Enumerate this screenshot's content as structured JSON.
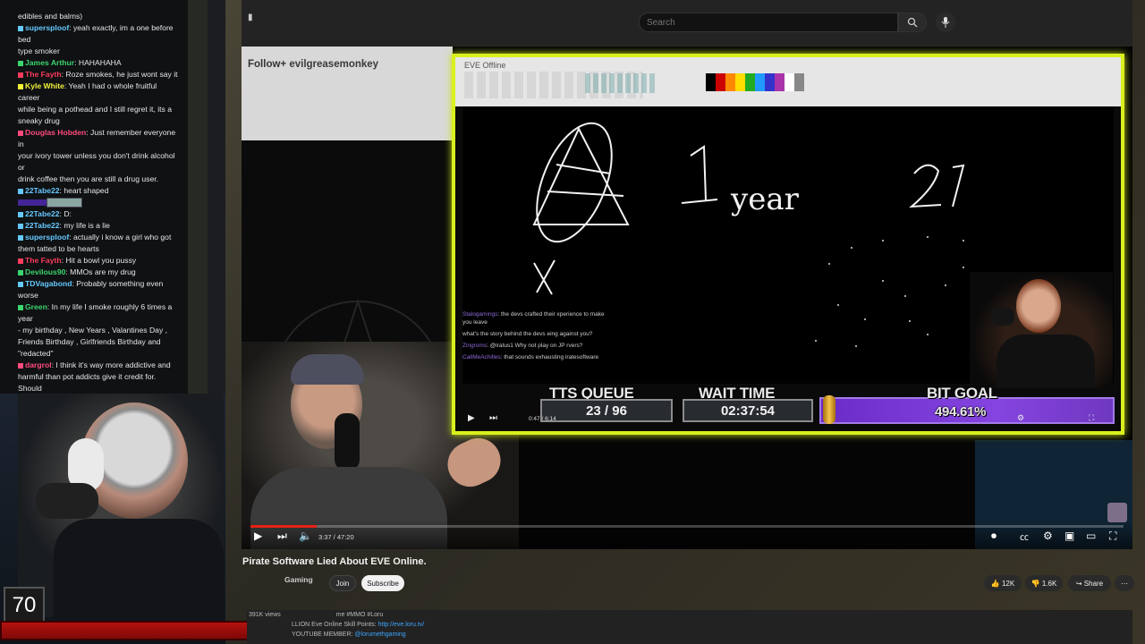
{
  "chat": {
    "messages": [
      {
        "user": "",
        "user_color": "#ffffff",
        "text": "edibles and balms)"
      },
      {
        "user": "supersploof",
        "user_color": "#66c8ff",
        "text": ": yeah exactly, im a one before bed"
      },
      {
        "user": "",
        "user_color": "#ffffff",
        "text": "type smoker"
      },
      {
        "user": "James Arthur",
        "user_color": "#3bd66e",
        "text": ": HAHAHAHA"
      },
      {
        "user": "The Fayth",
        "user_color": "#ff3b5c",
        "text": ": Roze smokes, he just wont say it"
      },
      {
        "user": "Kyle White",
        "user_color": "#f2f23a",
        "text": ": Yeah I had o whole fruitful career"
      },
      {
        "user": "",
        "user_color": "#ffffff",
        "text": "while being a pothead and I still regret it, its a"
      },
      {
        "user": "",
        "user_color": "#ffffff",
        "text": "sneaky drug"
      },
      {
        "user": "Douglas Hobden",
        "user_color": "#ff4a7d",
        "text": ": Just remember everyone in"
      },
      {
        "user": "",
        "user_color": "#ffffff",
        "text": "your ivory tower unless you don't drink alcohol or"
      },
      {
        "user": "",
        "user_color": "#ffffff",
        "text": "drink coffee then you are still a drug user."
      },
      {
        "user": "22Tabe22",
        "user_color": "#66c8ff",
        "text": ": heart shaped"
      },
      {
        "user": "",
        "user_color": "#ffffff",
        "text": ""
      },
      {
        "user": "22Tabe22",
        "user_color": "#66c8ff",
        "text": ": D:"
      },
      {
        "user": "22Tabe22",
        "user_color": "#66c8ff",
        "text": ": my life is a lie"
      },
      {
        "user": "supersploof",
        "user_color": "#66c8ff",
        "text": ": actually i know a girl who got"
      },
      {
        "user": "",
        "user_color": "#ffffff",
        "text": "them tatted to be hearts"
      },
      {
        "user": "The Fayth",
        "user_color": "#ff3b5c",
        "text": ": Hit a bowl you pussy"
      },
      {
        "user": "Devilous90",
        "user_color": "#3bd66e",
        "text": ": MMOs are my drug"
      },
      {
        "user": "TDVagabond",
        "user_color": "#66c8ff",
        "text": ": Probably something even worse"
      },
      {
        "user": "Green",
        "user_color": "#3bd66e",
        "text": ": In my life I smoke roughly 6 times a year"
      },
      {
        "user": "",
        "user_color": "#ffffff",
        "text": "- my birthday , New Years , Valantines Day ,"
      },
      {
        "user": "",
        "user_color": "#ffffff",
        "text": "Friends Birthday , Girlfriends Birthday and"
      },
      {
        "user": "",
        "user_color": "#ffffff",
        "text": "\"redacted\""
      },
      {
        "user": "dargrol",
        "user_color": "#ff4a7d",
        "text": ": I think it's way more addictive and"
      },
      {
        "user": "",
        "user_color": "#ffffff",
        "text": "harmful than pot addicts give it credit for. Should"
      },
      {
        "user": "",
        "user_color": "#ffffff",
        "text": "be banned everywhere."
      },
      {
        "user": "The Fayth",
        "user_color": "#ff3b5c",
        "text": ": dabs?"
      }
    ]
  },
  "counter": "70",
  "search": {
    "placeholder": "Search"
  },
  "follow": {
    "prefix": "Follow+",
    "user": "evilgreasemonkey"
  },
  "paint": {
    "title": "EVE Offline"
  },
  "drawing": {
    "text1": "1 year",
    "text2": "27",
    "text3": "X"
  },
  "stream_chat": [
    {
      "user": "Stalogamings",
      "text": ": the devs crafted their xperience to make you leave"
    },
    {
      "user": "",
      "text": "what's the story behind the devs eing against you?"
    },
    {
      "user": "Zingroms",
      "text": ": @iratus1 Why not play on JP rvers?"
    },
    {
      "user": "CallMeAchilles",
      "text": ": that sounds exhausting iratesoftware"
    }
  ],
  "overlay": {
    "tts_label": "TTS QUEUE",
    "tts_value": "23 / 96",
    "wait_label": "WAIT TIME",
    "wait_value": "02:37:54",
    "bit_label": "BIT GOAL",
    "bit_value": "494.61%"
  },
  "inner_time": "0:47 / 6:14",
  "player": {
    "time": "3:37 / 47:20",
    "progress": 0.076
  },
  "video": {
    "title": "Pirate Software Lied About EVE Online.",
    "channel": "Gaming",
    "join": "Join",
    "subscribe": "Subscribe",
    "likes": "12K",
    "dislikes": "1.6K",
    "share": "Share"
  },
  "description": {
    "views": "391K views",
    "line1_text": "LLION Eve Online Skill Points: ",
    "line1_link": "http://eve.loru.tv/",
    "line2_text": "YOUTUBE MEMBER: ",
    "line2_link": "@lorumethgaming",
    "tags": "me #MMO #Loru"
  },
  "colors": {
    "accent_yellow": "#d9f01d",
    "yt_red": "#e62117",
    "bit_purple": "#7a3fd6"
  }
}
